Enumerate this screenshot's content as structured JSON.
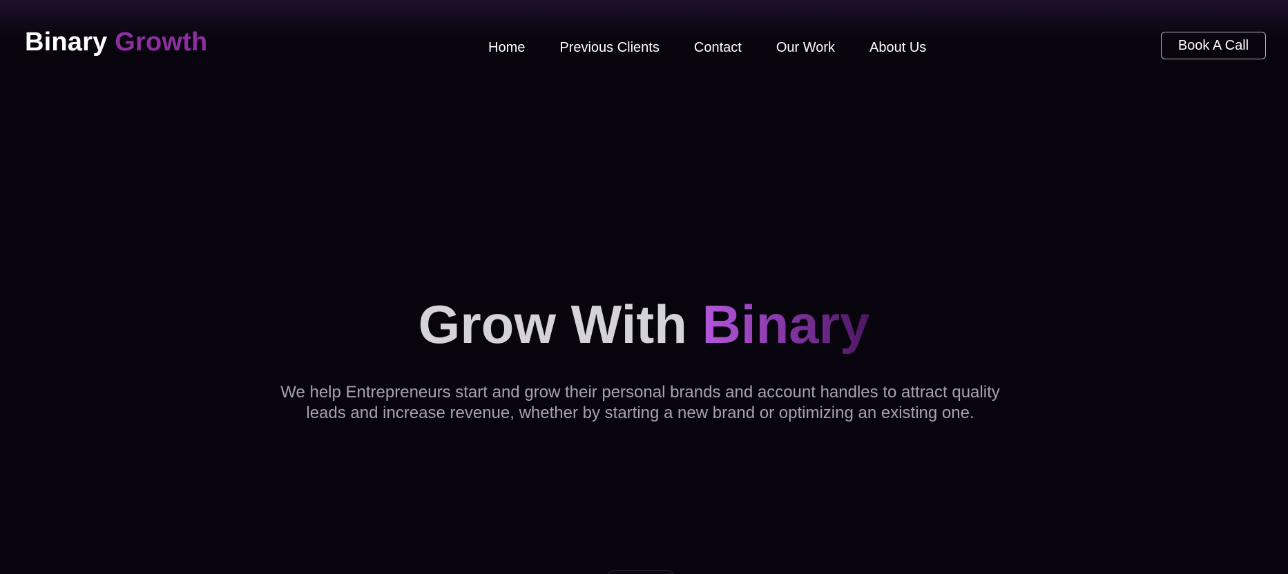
{
  "header": {
    "logo": {
      "word1": "Binary",
      "word2": "Growth"
    },
    "nav": [
      {
        "label": "Home"
      },
      {
        "label": "Previous Clients"
      },
      {
        "label": "Contact"
      },
      {
        "label": "Our Work"
      },
      {
        "label": "About Us"
      }
    ],
    "cta_label": "Book A Call"
  },
  "hero": {
    "title_plain": "Grow With",
    "title_highlight": "Binary",
    "subtitle_line1": "We help Entrepreneurs start and grow their personal brands and account handles to attract quality",
    "subtitle_line2": "leads and increase revenue, whether by starting a new brand or optimizing an existing one."
  },
  "colors": {
    "background": "#07040d",
    "accent": "#8e2ea1",
    "gradient_start": "#b457dc",
    "gradient_end": "#4a1660",
    "title_text": "#d5d3da",
    "subtitle_text": "#a6a3ad"
  }
}
